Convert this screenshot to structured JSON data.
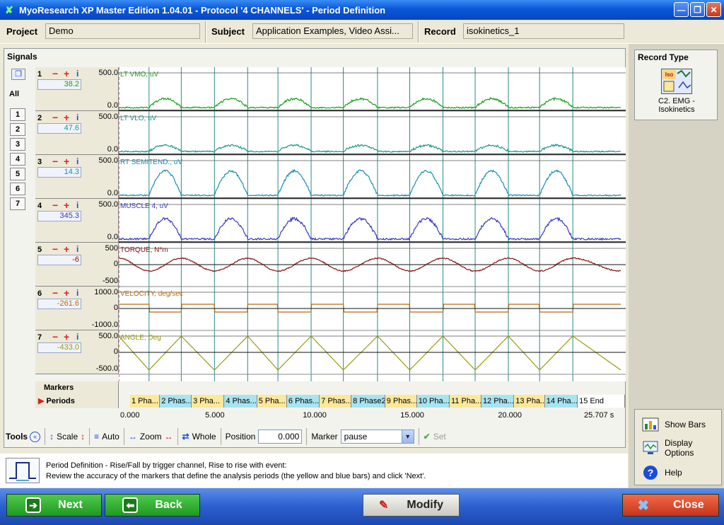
{
  "window": {
    "title": "MyoResearch XP Master Edition 1.04.01 - Protocol '4 CHANNELS' - Period Definition"
  },
  "fields": {
    "project_label": "Project",
    "project_value": "Demo",
    "subject_label": "Subject",
    "subject_value": "Application Examples, Video Assi...",
    "record_label": "Record",
    "record_value": "isokinetics_1"
  },
  "signals": {
    "title": "Signals",
    "all_label": "All",
    "channel_buttons": [
      "1",
      "2",
      "3",
      "4",
      "5",
      "6",
      "7"
    ],
    "channels": [
      {
        "num": "1",
        "value": "38.2",
        "name": "LT VMO, uV",
        "scale_top": "500.0",
        "scale_mid": "",
        "scale_bottom": "0.0",
        "color": "#19a019"
      },
      {
        "num": "2",
        "value": "47.6",
        "name": "LT VLO, uV",
        "scale_top": "500.0",
        "scale_mid": "",
        "scale_bottom": "0.0",
        "color": "#1a9a8a"
      },
      {
        "num": "3",
        "value": "14.3",
        "name": "RT SEMITEND., uV",
        "scale_top": "500.0",
        "scale_mid": "",
        "scale_bottom": "0.0",
        "color": "#1a8cb8"
      },
      {
        "num": "4",
        "value": "345.3",
        "name": "MUSCLE 4, uV",
        "scale_top": "500.0",
        "scale_mid": "",
        "scale_bottom": "0.0",
        "color": "#3838c8"
      },
      {
        "num": "5",
        "value": "-6",
        "name": "TORQUE, N*m",
        "scale_top": "500",
        "scale_mid": "0",
        "scale_bottom": "-500",
        "color": "#8c1010"
      },
      {
        "num": "6",
        "value": "-261.6",
        "name": "VELOCITY, deg/sec",
        "scale_top": "1000.0",
        "scale_mid": "0",
        "scale_bottom": "-1000.0",
        "color": "#b86a10"
      },
      {
        "num": "7",
        "value": "-433.0",
        "name": "ANGLE, Deg",
        "scale_top": "500.0",
        "scale_mid": "0",
        "scale_bottom": "-500.0",
        "color": "#9a9a10"
      }
    ],
    "markers_label": "Markers",
    "periods_label": "Periods",
    "periods": [
      {
        "label": "1 Pha...",
        "start": 0.0,
        "end": 1.55,
        "color": "#fce89a"
      },
      {
        "label": "2 Phas...",
        "start": 1.55,
        "end": 3.2,
        "color": "#a8e4f0"
      },
      {
        "label": "3 Pha...",
        "start": 3.2,
        "end": 4.9,
        "color": "#fce89a"
      },
      {
        "label": "4 Phas...",
        "start": 4.9,
        "end": 6.6,
        "color": "#a8e4f0"
      },
      {
        "label": "5 Pha...",
        "start": 6.6,
        "end": 8.15,
        "color": "#fce89a"
      },
      {
        "label": "6 Phas...",
        "start": 8.15,
        "end": 9.85,
        "color": "#a8e4f0"
      },
      {
        "label": "7 Phas...",
        "start": 9.85,
        "end": 11.5,
        "color": "#fce89a"
      },
      {
        "label": "8 Phase2",
        "start": 11.5,
        "end": 13.25,
        "color": "#a8e4f0"
      },
      {
        "label": "9 Phas...",
        "start": 13.25,
        "end": 14.9,
        "color": "#fce89a"
      },
      {
        "label": "10 Pha...",
        "start": 14.9,
        "end": 16.6,
        "color": "#a8e4f0"
      },
      {
        "label": "11 Pha...",
        "start": 16.6,
        "end": 18.25,
        "color": "#fce89a"
      },
      {
        "label": "12 Pha...",
        "start": 18.25,
        "end": 19.95,
        "color": "#a8e4f0"
      },
      {
        "label": "13 Pha...",
        "start": 19.95,
        "end": 21.55,
        "color": "#fce89a"
      },
      {
        "label": "14 Pha...",
        "start": 21.55,
        "end": 23.25,
        "color": "#a8e4f0"
      },
      {
        "label": "15 End",
        "start": 23.25,
        "end": 25.707,
        "color": "#ffffff"
      }
    ],
    "time_ticks": [
      "0.000",
      "5.000",
      "10.000",
      "15.000",
      "20.000",
      "25.707 s"
    ],
    "time_end": 25.707
  },
  "tools": {
    "label": "Tools",
    "scale_label": "Scale",
    "auto_label": "Auto",
    "zoom_label": "Zoom",
    "whole_label": "Whole",
    "position_label": "Position",
    "position_value": "0.000",
    "marker_label": "Marker",
    "marker_value": "pause",
    "set_label": "Set"
  },
  "description": {
    "line1": "Period Definition - Rise/Fall by trigger channel, Rise to rise with event:",
    "line2": "Review the accuracy of the markers that define the analysis periods (the yellow and blue bars) and click 'Next'."
  },
  "record_type": {
    "title": "Record Type",
    "icon_text": "Iso",
    "item_label": "C2. EMG -\nIsokinetics"
  },
  "help_panel": {
    "show_bars": "Show Bars",
    "display_options": "Display\nOptions",
    "help": "Help"
  },
  "bottom": {
    "next": "Next",
    "back": "Back",
    "modify": "Modify",
    "close": "Close"
  }
}
